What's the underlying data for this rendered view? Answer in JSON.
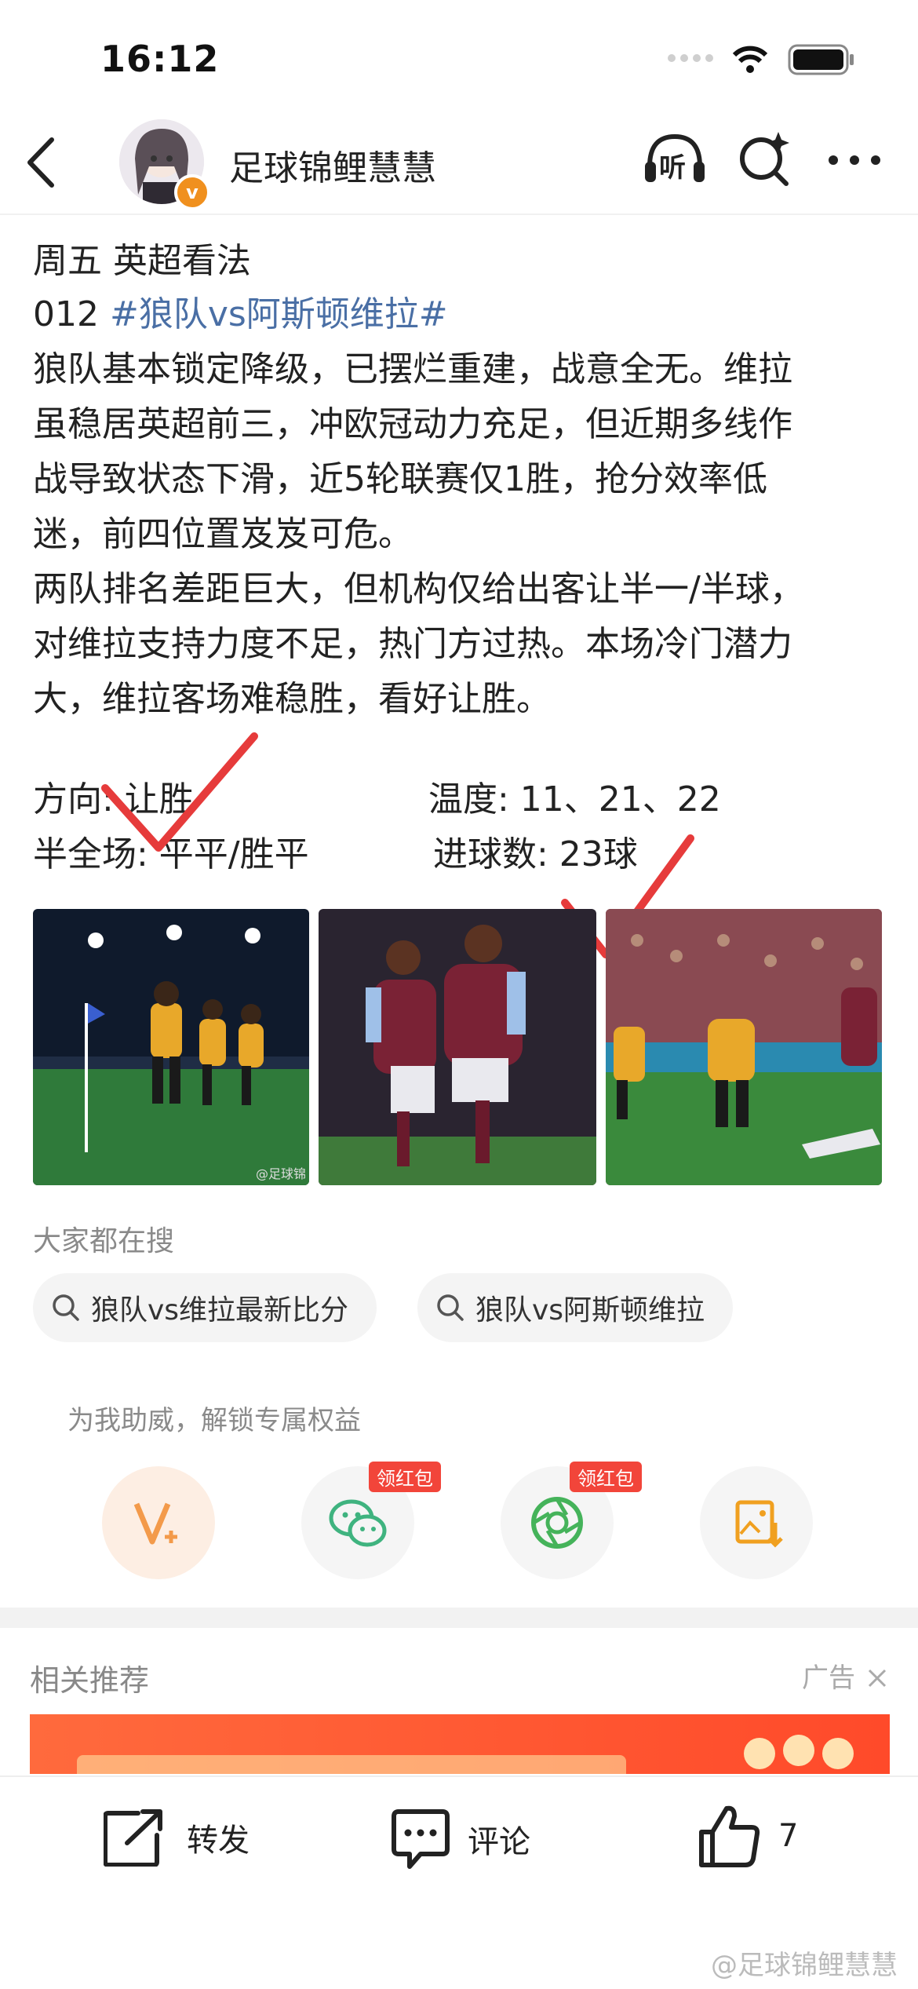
{
  "status_bar": {
    "time": "16:12"
  },
  "header": {
    "username": "足球锦鲤慧慧",
    "verified_badge": "v",
    "icons": [
      "back-icon",
      "listen-icon",
      "search-icon",
      "more-icon"
    ],
    "listen_label": "听"
  },
  "post": {
    "line1": "周五 英超看法",
    "line2_prefix": "012 ",
    "line2_tag": "#狼队vs阿斯顿维拉#",
    "paragraph1": [
      "狼队基本锁定降级，已摆烂重建，战意全无。维拉",
      "虽稳居英超前三，冲欧冠动力充足，但近期多线作",
      "战导致状态下滑，近5轮联赛仅1胜，抢分效率低",
      "迷，前四位置岌岌可危。"
    ],
    "paragraph2": [
      "两队排名差距巨大，但机构仅给出客让半一/半球，",
      "对维拉支持力度不足，热门方过热。本场冷门潜力",
      "大，维拉客场难稳胜，看好让胜。"
    ],
    "picks": {
      "direction": "方向: 让胜",
      "halffull": "半全场: 平平/胜平",
      "temperature": "温度: 11、21、22",
      "goals": "进球数: 23球"
    },
    "image_watermark": "@足球锦"
  },
  "search_section": {
    "title": "大家都在搜",
    "items": [
      "狼队vs维拉最新比分",
      "狼队vs阿斯顿维拉"
    ]
  },
  "support": {
    "text": "为我助威，解锁专属权益",
    "red_packet_label": "领红包"
  },
  "related": {
    "title": "相关推荐",
    "ad_label": "广告"
  },
  "bottom_bar": {
    "share": "转发",
    "comment": "评论",
    "like_count": "7"
  },
  "watermark": "@足球锦鲤慧慧",
  "colors": {
    "accent": "#4a6fa5",
    "red_check": "#e63b3b",
    "orange": "#f0901e",
    "red_packet": "#f2453a"
  }
}
